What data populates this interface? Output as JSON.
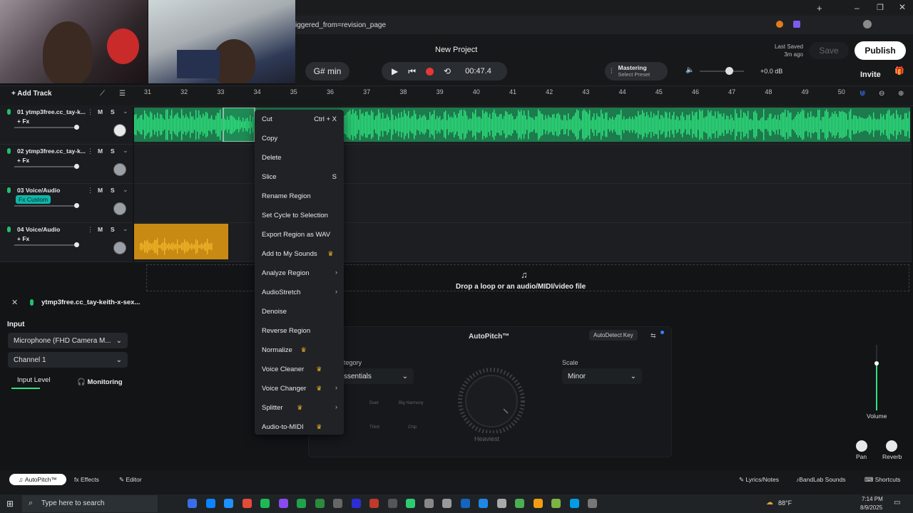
{
  "browser": {
    "url_fragment": "iggered_from=revision_page"
  },
  "header": {
    "project_title": "New Project",
    "key": "G# min",
    "time": "00:47.4",
    "mastering_label": "Mastering",
    "mastering_preset": "Select Preset",
    "volume_db": "+0.0 dB",
    "last_saved_label": "Last Saved",
    "last_saved_time": "3m ago",
    "save_label": "Save",
    "publish_label": "Publish",
    "invite_label": "Invite"
  },
  "toolbar": {
    "add_track_label": "Add Track"
  },
  "ruler": [
    "31",
    "32",
    "33",
    "34",
    "35",
    "36",
    "37",
    "38",
    "39",
    "40",
    "41",
    "42",
    "43",
    "44",
    "45",
    "46",
    "47",
    "48",
    "49",
    "50"
  ],
  "tracks": [
    {
      "name": "01  ytmp3free.cc_tay-k...",
      "fx": "+ Fx",
      "mute": "M",
      "solo": "S"
    },
    {
      "name": "02  ytmp3free.cc_tay-k...",
      "fx": "+ Fx",
      "mute": "M",
      "solo": "S"
    },
    {
      "name": "03  Voice/Audio",
      "fx": "Fx Custom",
      "mute": "M",
      "solo": "S"
    },
    {
      "name": "04  Voice/Audio",
      "fx": "+ Fx",
      "mute": "M",
      "solo": "S"
    }
  ],
  "drop_zone": {
    "text": "Drop a loop or an audio/MIDI/video file"
  },
  "context_menu": [
    {
      "label": "Cut",
      "shortcut": "Ctrl + X"
    },
    {
      "label": "Copy"
    },
    {
      "label": "Delete"
    },
    {
      "label": "Slice",
      "shortcut": "S"
    },
    {
      "label": "Rename Region"
    },
    {
      "label": "Set Cycle to Selection"
    },
    {
      "label": "Export Region as WAV"
    },
    {
      "label": "Add to My Sounds",
      "premium": true
    },
    {
      "label": "Analyze Region",
      "submenu": true
    },
    {
      "label": "AudioStretch",
      "submenu": true
    },
    {
      "label": "Denoise"
    },
    {
      "label": "Reverse Region"
    },
    {
      "label": "Normalize",
      "premium": true
    },
    {
      "label": "Voice Cleaner",
      "premium": true
    },
    {
      "label": "Voice Changer",
      "premium": true,
      "submenu": true
    },
    {
      "label": "Splitter",
      "premium": true,
      "submenu": true
    },
    {
      "label": "Audio-to-MIDI",
      "premium": true
    }
  ],
  "bottom_panel": {
    "track_title": "ytmp3free.cc_tay-keith-x-sex...",
    "input_label": "Input",
    "input_device": "Microphone (FHD Camera M...",
    "channel": "Channel 1",
    "input_level_label": "Input Level",
    "monitoring_label": "Monitoring",
    "autopitch_title": "AutoPitch™",
    "autodetect_label": "AutoDetect Key",
    "category_label": "tegory",
    "category_value": "ssentials",
    "scale_label": "Scale",
    "scale_value": "Minor",
    "dial_label": "Heaviest",
    "presets": [
      "Duet",
      "Big Harmony",
      "Third",
      "Chip"
    ],
    "volume_label": "Volume",
    "pan_label": "Pan",
    "reverb_label": "Reverb"
  },
  "bottom_bar": {
    "autopitch_tab": "AutoPitch™",
    "effects_tab": "Effects",
    "editor_tab": "Editor",
    "lyrics_label": "Lyrics/Notes",
    "bandlab_sounds_label": "BandLab Sounds",
    "shortcuts_label": "Shortcuts"
  },
  "taskbar": {
    "search_placeholder": "Type here to search",
    "temperature": "88°F",
    "time": "7:14 PM",
    "date": "8/9/2025"
  },
  "colors": {
    "accent_green": "#2ee37f",
    "region_orange": "#e8a51b",
    "record_red": "#e53935",
    "fx_custom_teal": "#0fb5a8",
    "premium_gold": "#f0b429"
  }
}
